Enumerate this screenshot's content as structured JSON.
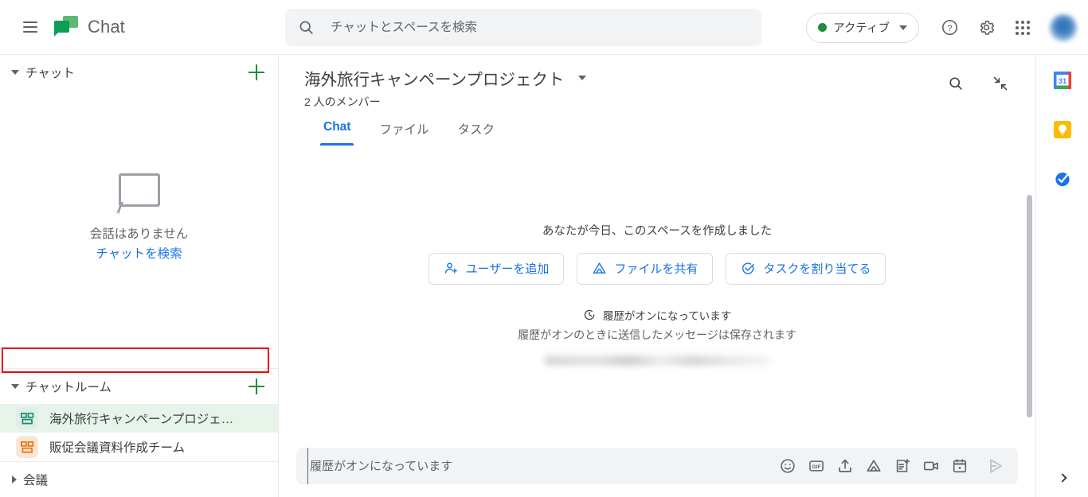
{
  "topbar": {
    "menu_icon": "hamburger-icon",
    "app_name": "Chat",
    "logo_icon": "google-chat-logo",
    "search": {
      "icon": "search-icon",
      "placeholder": "チャットとスペースを検索",
      "value": ""
    },
    "status": {
      "label": "アクティブ",
      "dot_color": "#1e8e3e",
      "caret_icon": "chevron-down-icon"
    },
    "help_icon": "help-circle-icon",
    "settings_icon": "gear-icon",
    "apps_icon": "apps-grid-icon",
    "avatar": "user-avatar"
  },
  "sidebar": {
    "chat_section": {
      "title": "チャット",
      "collapse_icon": "triangle-down-icon",
      "add_icon": "plus-icon",
      "empty": {
        "icon": "chat-bubble-outline-icon",
        "text": "会話はありません",
        "link": "チャットを検索"
      }
    },
    "rooms_section": {
      "title": "チャットルーム",
      "collapse_icon": "triangle-down-icon",
      "add_icon": "plus-icon",
      "items": [
        {
          "label": "海外旅行キャンペーンプロジェ…",
          "icon": "space-avatar-icon",
          "color": "teal",
          "selected": true
        },
        {
          "label": "販促会議資料作成チーム",
          "icon": "space-avatar-icon",
          "color": "orange",
          "selected": false
        }
      ]
    },
    "meetings_section": {
      "title": "会議",
      "expand_icon": "triangle-right-icon"
    },
    "highlight_color": "#ee0000"
  },
  "main": {
    "space_title": "海外旅行キャンペーンプロジェクト",
    "title_caret_icon": "chevron-down-icon",
    "members": "2 人のメンバー",
    "tabs": [
      {
        "label": "Chat",
        "active": true
      },
      {
        "label": "ファイル",
        "active": false
      },
      {
        "label": "タスク",
        "active": false
      }
    ],
    "header_actions": [
      {
        "icon": "search-icon",
        "name": "search-in-space-button"
      },
      {
        "icon": "collapse-arrows-icon",
        "name": "collapse-button"
      }
    ],
    "created_text": "あなたが今日、このスペースを作成しました",
    "action_buttons": [
      {
        "label": "ユーザーを追加",
        "icon": "add-person-icon"
      },
      {
        "label": "ファイルを共有",
        "icon": "drive-triangle-icon"
      },
      {
        "label": "タスクを割り当てる",
        "icon": "task-check-icon"
      }
    ],
    "history": {
      "icon": "history-clock-icon",
      "title": "履歴がオンになっています",
      "subtitle": "履歴がオンのときに送信したメッセージは保存されます"
    },
    "composer": {
      "placeholder": "履歴がオンになっています",
      "value": "",
      "icons": [
        {
          "name": "emoji-icon"
        },
        {
          "name": "gif-icon",
          "label": "GIF"
        },
        {
          "name": "upload-icon"
        },
        {
          "name": "drive-icon"
        },
        {
          "name": "new-doc-icon"
        },
        {
          "name": "video-camera-icon"
        },
        {
          "name": "calendar-icon"
        }
      ],
      "send_icon": "send-icon"
    }
  },
  "rail": {
    "items": [
      {
        "name": "google-calendar-icon",
        "label": "31"
      },
      {
        "name": "google-keep-icon"
      },
      {
        "name": "google-tasks-icon"
      }
    ],
    "expand_icon": "chevron-right-icon"
  },
  "accent": {
    "blue": "#1a73e8",
    "green": "#1e8e3e",
    "grey": "#5f6368"
  }
}
